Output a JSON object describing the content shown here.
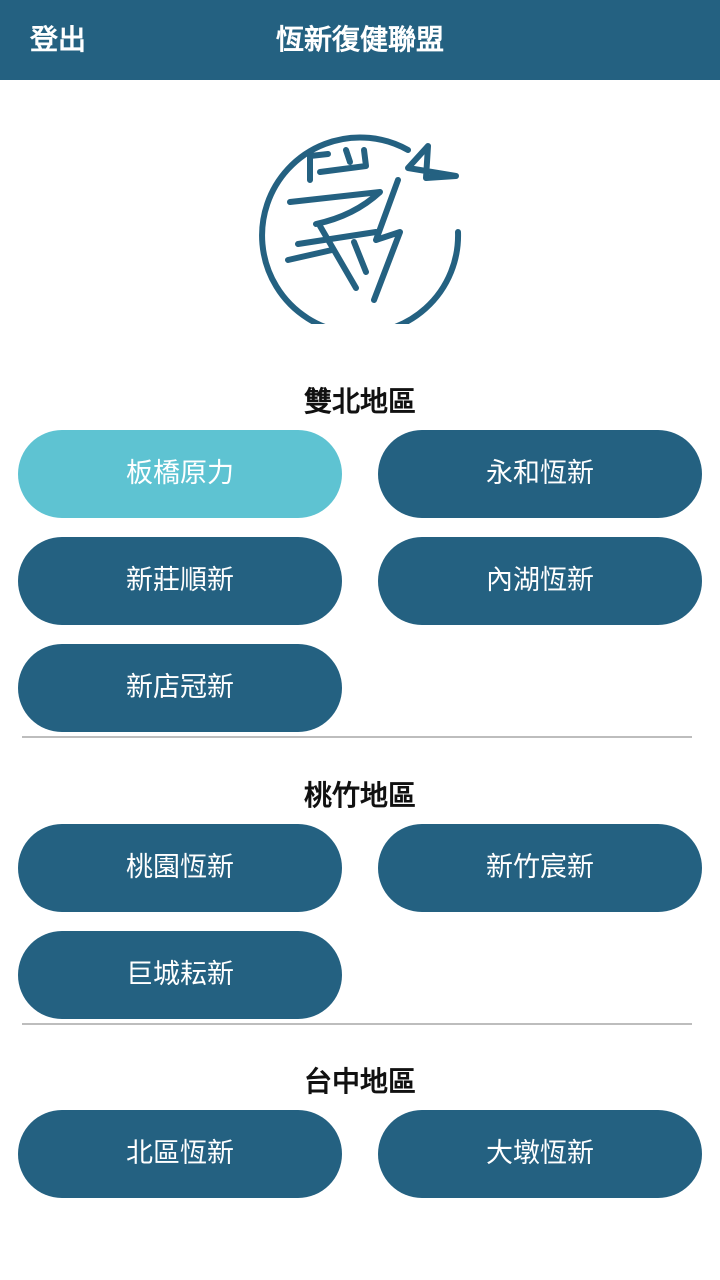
{
  "header": {
    "logout_label": "登出",
    "title": "恆新復健聯盟"
  },
  "logo": {
    "icon": "xin-logo-icon",
    "color": "#246181"
  },
  "sections": [
    {
      "title": "雙北地區",
      "branches": [
        "板橋原力",
        "永和恆新",
        "新莊順新",
        "內湖恆新",
        "新店冠新"
      ]
    },
    {
      "title": "桃竹地區",
      "branches": [
        "桃園恆新",
        "新竹宸新",
        "巨城耘新"
      ]
    },
    {
      "title": "台中地區",
      "branches": [
        "北區恆新",
        "大墩恆新"
      ]
    }
  ],
  "selected_branch": "板橋原力",
  "colors": {
    "primary": "#246181",
    "selected": "#5ec3d2",
    "divider": "#bdbdbd"
  }
}
